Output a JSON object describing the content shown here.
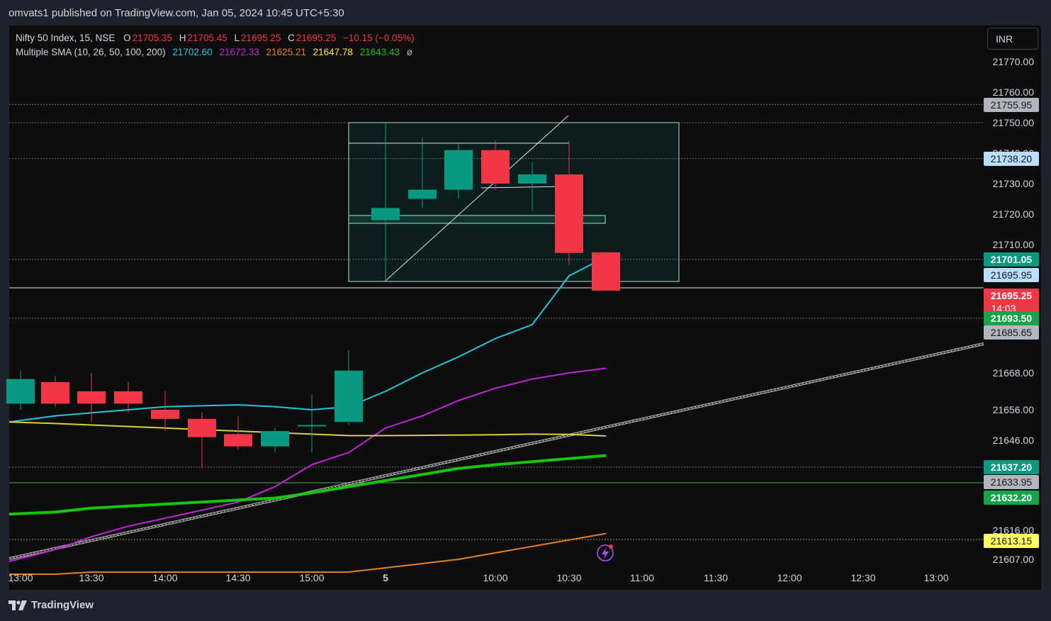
{
  "header": {
    "publisher": "omvats1 published on TradingView.com, Jan 05, 2024 10:45 UTC+5:30"
  },
  "footer": {
    "brand": "TradingView"
  },
  "currency": "INR",
  "legend": {
    "symbol": "Nifty 50 Index, 15, NSE",
    "open_label": "O",
    "open": "21705.35",
    "high_label": "H",
    "high": "21705.45",
    "low_label": "L",
    "low": "21695.25",
    "close_label": "C",
    "close": "21695.25",
    "change": "−10.15 (−0.05%)",
    "sma_title": "Multiple SMA (10, 26, 50, 100, 200)",
    "sma_values": [
      "21702.60",
      "21672.33",
      "21625.21",
      "21647.78",
      "21643.43"
    ],
    "sma_tail": "ø"
  },
  "colors": {
    "up": "#089981",
    "down": "#f23645",
    "sma10": "#26c6da",
    "sma26": "#c026d3",
    "sma50": "#e6821e",
    "sma100": "#d4d43a",
    "sma200": "#16c60c",
    "background": "#0d0d0d",
    "frame": "#1e222d"
  },
  "chart_data": {
    "type": "candlestick",
    "title": "Nifty 50 Index, 15, NSE",
    "y_ticks": [
      "21770.00",
      "21760.00",
      "21750.00",
      "21740.00",
      "21730.00",
      "21720.00",
      "21710.00",
      "21668.00",
      "21656.00",
      "21646.00",
      "21616.00",
      "21607.00"
    ],
    "x_ticks": [
      "13:00",
      "13:30",
      "14:00",
      "14:30",
      "15:00",
      "5",
      "10:00",
      "10:30",
      "11:00",
      "11:30",
      "12:00",
      "12:30",
      "13:00"
    ],
    "ylim": [
      21600,
      21775
    ],
    "candles": [
      {
        "time": "Jan 4 13:00",
        "open": 21658,
        "high": 21669,
        "low": 21656,
        "close": 21666
      },
      {
        "time": "Jan 4 13:15",
        "open": 21665,
        "high": 21667,
        "low": 21657,
        "close": 21658
      },
      {
        "time": "Jan 4 13:30",
        "open": 21662,
        "high": 21668,
        "low": 21652,
        "close": 21658
      },
      {
        "time": "Jan 4 13:45",
        "open": 21662,
        "high": 21665,
        "low": 21655,
        "close": 21658
      },
      {
        "time": "Jan 4 14:00",
        "open": 21656,
        "high": 21662,
        "low": 21649,
        "close": 21653
      },
      {
        "time": "Jan 4 14:15",
        "open": 21653,
        "high": 21655,
        "low": 21637,
        "close": 21647
      },
      {
        "time": "Jan 4 14:30",
        "open": 21648,
        "high": 21654,
        "low": 21643,
        "close": 21644
      },
      {
        "time": "Jan 4 14:45",
        "open": 21644,
        "high": 21650,
        "low": 21642,
        "close": 21649
      },
      {
        "time": "Jan 4 15:00",
        "open": 21651,
        "high": 21661,
        "low": 21642,
        "close": 21651
      },
      {
        "time": "Jan 4 15:15",
        "open": 21652,
        "high": 21678,
        "low": 21651,
        "close": 21669
      },
      {
        "time": "Jan 5 09:15",
        "open": 21718,
        "high": 21750,
        "low": 21697,
        "close": 21722
      },
      {
        "time": "Jan 5 09:30",
        "open": 21725,
        "high": 21745,
        "low": 21722,
        "close": 21728
      },
      {
        "time": "Jan 5 09:45",
        "open": 21728,
        "high": 21743,
        "low": 21725,
        "close": 21741
      },
      {
        "time": "Jan 5 10:00",
        "open": 21741,
        "high": 21744,
        "low": 21728,
        "close": 21730
      },
      {
        "time": "Jan 5 10:15",
        "open": 21730,
        "high": 21737,
        "low": 21721,
        "close": 21733
      },
      {
        "time": "Jan 5 10:30",
        "open": 21733,
        "high": 21744,
        "low": 21700,
        "close": 21705
      },
      {
        "time": "Jan 5 10:45",
        "open": 21705.35,
        "high": 21705.45,
        "low": 21695.25,
        "close": 21695.25
      }
    ],
    "sma": [
      {
        "name": "SMA 10",
        "values": [
          21652,
          21654,
          21655,
          21656,
          21657,
          21657.3,
          21657.6,
          21657,
          21656,
          21657,
          21662,
          21668,
          21675,
          21683,
          21690,
          21698,
          21702.6
        ]
      },
      {
        "name": "SMA 26",
        "values": [
          21606,
          21610,
          21614,
          21618,
          21622,
          21626,
          21630,
          21634,
          21638,
          21642,
          21650,
          21654,
          21659,
          21663,
          21666,
          21668,
          21670
        ]
      },
      {
        "name": "SMA 50",
        "values": [
          21599,
          21600,
          21601,
          21601,
          21601,
          21601,
          21601,
          21601,
          21601,
          21601,
          21603,
          21605,
          21607,
          21609,
          21611,
          21613,
          21615
        ]
      },
      {
        "name": "SMA 100",
        "values": [
          21652,
          21651.5,
          21651,
          21650.5,
          21650,
          21649.5,
          21649,
          21648.5,
          21648,
          21647.5,
          21647.5,
          21647.6,
          21647.7,
          21647.8,
          21648,
          21647.9,
          21647.4
        ]
      },
      {
        "name": "SMA 200",
        "values": [
          21624,
          21625,
          21627,
          21628,
          21629,
          21630,
          21631,
          21632,
          21633,
          21634,
          21635,
          21636,
          21637,
          21638,
          21639,
          21640,
          21641
        ]
      }
    ],
    "price_labels": [
      {
        "value": "21755.95",
        "bg": "#b2b5be",
        "fg": "#131722"
      },
      {
        "value": "21738.20",
        "bg": "#bbdefb",
        "fg": "#131722"
      },
      {
        "value": "21701.05",
        "bg": "#089981",
        "fg": "#ffffff"
      },
      {
        "value": "21695.95",
        "bg": "#bbdefb",
        "fg": "#131722"
      },
      {
        "value": "21695.25",
        "sub": "14:03",
        "bg": "#f23645",
        "fg": "#ffffff"
      },
      {
        "value": "21693.50",
        "bg": "#16a34a",
        "fg": "#ffffff"
      },
      {
        "value": "21685.65",
        "bg": "#b2b5be",
        "fg": "#131722"
      },
      {
        "value": "21637.20",
        "bg": "#089981",
        "fg": "#ffffff"
      },
      {
        "value": "21633.95",
        "bg": "#b2b5be",
        "fg": "#131722"
      },
      {
        "value": "21632.20",
        "bg": "#16a34a",
        "fg": "#ffffff"
      },
      {
        "value": "21613.15",
        "bg": "#ffff66",
        "fg": "#131722"
      }
    ]
  }
}
